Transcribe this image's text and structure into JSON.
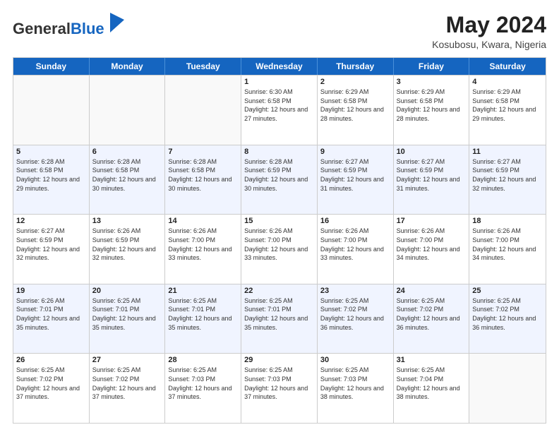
{
  "header": {
    "logo_general": "General",
    "logo_blue": "Blue",
    "month_year": "May 2024",
    "location": "Kosubosu, Kwara, Nigeria"
  },
  "days_of_week": [
    "Sunday",
    "Monday",
    "Tuesday",
    "Wednesday",
    "Thursday",
    "Friday",
    "Saturday"
  ],
  "weeks": [
    [
      {
        "day": "",
        "info": ""
      },
      {
        "day": "",
        "info": ""
      },
      {
        "day": "",
        "info": ""
      },
      {
        "day": "1",
        "info": "Sunrise: 6:30 AM\nSunset: 6:58 PM\nDaylight: 12 hours\nand 27 minutes."
      },
      {
        "day": "2",
        "info": "Sunrise: 6:29 AM\nSunset: 6:58 PM\nDaylight: 12 hours\nand 28 minutes."
      },
      {
        "day": "3",
        "info": "Sunrise: 6:29 AM\nSunset: 6:58 PM\nDaylight: 12 hours\nand 28 minutes."
      },
      {
        "day": "4",
        "info": "Sunrise: 6:29 AM\nSunset: 6:58 PM\nDaylight: 12 hours\nand 29 minutes."
      }
    ],
    [
      {
        "day": "5",
        "info": "Sunrise: 6:28 AM\nSunset: 6:58 PM\nDaylight: 12 hours\nand 29 minutes."
      },
      {
        "day": "6",
        "info": "Sunrise: 6:28 AM\nSunset: 6:58 PM\nDaylight: 12 hours\nand 30 minutes."
      },
      {
        "day": "7",
        "info": "Sunrise: 6:28 AM\nSunset: 6:58 PM\nDaylight: 12 hours\nand 30 minutes."
      },
      {
        "day": "8",
        "info": "Sunrise: 6:28 AM\nSunset: 6:59 PM\nDaylight: 12 hours\nand 30 minutes."
      },
      {
        "day": "9",
        "info": "Sunrise: 6:27 AM\nSunset: 6:59 PM\nDaylight: 12 hours\nand 31 minutes."
      },
      {
        "day": "10",
        "info": "Sunrise: 6:27 AM\nSunset: 6:59 PM\nDaylight: 12 hours\nand 31 minutes."
      },
      {
        "day": "11",
        "info": "Sunrise: 6:27 AM\nSunset: 6:59 PM\nDaylight: 12 hours\nand 32 minutes."
      }
    ],
    [
      {
        "day": "12",
        "info": "Sunrise: 6:27 AM\nSunset: 6:59 PM\nDaylight: 12 hours\nand 32 minutes."
      },
      {
        "day": "13",
        "info": "Sunrise: 6:26 AM\nSunset: 6:59 PM\nDaylight: 12 hours\nand 32 minutes."
      },
      {
        "day": "14",
        "info": "Sunrise: 6:26 AM\nSunset: 7:00 PM\nDaylight: 12 hours\nand 33 minutes."
      },
      {
        "day": "15",
        "info": "Sunrise: 6:26 AM\nSunset: 7:00 PM\nDaylight: 12 hours\nand 33 minutes."
      },
      {
        "day": "16",
        "info": "Sunrise: 6:26 AM\nSunset: 7:00 PM\nDaylight: 12 hours\nand 33 minutes."
      },
      {
        "day": "17",
        "info": "Sunrise: 6:26 AM\nSunset: 7:00 PM\nDaylight: 12 hours\nand 34 minutes."
      },
      {
        "day": "18",
        "info": "Sunrise: 6:26 AM\nSunset: 7:00 PM\nDaylight: 12 hours\nand 34 minutes."
      }
    ],
    [
      {
        "day": "19",
        "info": "Sunrise: 6:26 AM\nSunset: 7:01 PM\nDaylight: 12 hours\nand 35 minutes."
      },
      {
        "day": "20",
        "info": "Sunrise: 6:25 AM\nSunset: 7:01 PM\nDaylight: 12 hours\nand 35 minutes."
      },
      {
        "day": "21",
        "info": "Sunrise: 6:25 AM\nSunset: 7:01 PM\nDaylight: 12 hours\nand 35 minutes."
      },
      {
        "day": "22",
        "info": "Sunrise: 6:25 AM\nSunset: 7:01 PM\nDaylight: 12 hours\nand 35 minutes."
      },
      {
        "day": "23",
        "info": "Sunrise: 6:25 AM\nSunset: 7:02 PM\nDaylight: 12 hours\nand 36 minutes."
      },
      {
        "day": "24",
        "info": "Sunrise: 6:25 AM\nSunset: 7:02 PM\nDaylight: 12 hours\nand 36 minutes."
      },
      {
        "day": "25",
        "info": "Sunrise: 6:25 AM\nSunset: 7:02 PM\nDaylight: 12 hours\nand 36 minutes."
      }
    ],
    [
      {
        "day": "26",
        "info": "Sunrise: 6:25 AM\nSunset: 7:02 PM\nDaylight: 12 hours\nand 37 minutes."
      },
      {
        "day": "27",
        "info": "Sunrise: 6:25 AM\nSunset: 7:02 PM\nDaylight: 12 hours\nand 37 minutes."
      },
      {
        "day": "28",
        "info": "Sunrise: 6:25 AM\nSunset: 7:03 PM\nDaylight: 12 hours\nand 37 minutes."
      },
      {
        "day": "29",
        "info": "Sunrise: 6:25 AM\nSunset: 7:03 PM\nDaylight: 12 hours\nand 37 minutes."
      },
      {
        "day": "30",
        "info": "Sunrise: 6:25 AM\nSunset: 7:03 PM\nDaylight: 12 hours\nand 38 minutes."
      },
      {
        "day": "31",
        "info": "Sunrise: 6:25 AM\nSunset: 7:04 PM\nDaylight: 12 hours\nand 38 minutes."
      },
      {
        "day": "",
        "info": ""
      }
    ]
  ]
}
